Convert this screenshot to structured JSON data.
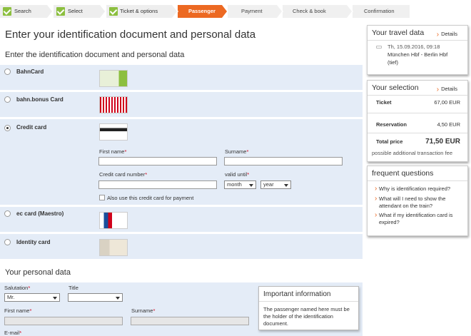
{
  "steps": [
    {
      "label": "Search",
      "state": "done"
    },
    {
      "label": "Select",
      "state": "done"
    },
    {
      "label": "Ticket & options",
      "state": "done"
    },
    {
      "label": "Passenger",
      "state": "active"
    },
    {
      "label": "Payment",
      "state": "todo"
    },
    {
      "label": "Check & book",
      "state": "todo"
    },
    {
      "label": "Confirmation",
      "state": "todo"
    }
  ],
  "page_title": "Enter your identification document and personal data",
  "subtitle": "Enter the identification document and personal data",
  "options": {
    "bahncard": "BahnCard",
    "bonus": "bahn.bonus Card",
    "credit": "Credit card",
    "ec": "ec card (Maestro)",
    "identity": "Identity card"
  },
  "credit_form": {
    "first_name": "First name",
    "surname": "Surname",
    "card_number": "Credit card number",
    "valid_until": "valid until",
    "month": "month",
    "year": "year",
    "also_use": "Also use this credit card for payment",
    "req": "*"
  },
  "personal": {
    "heading": "Your personal data",
    "salutation": "Salutation",
    "salutation_value": "Mr.",
    "title": "Title",
    "title_value": "",
    "first_name": "First name",
    "surname": "Surname",
    "email": "E-mail"
  },
  "info_box": {
    "title": "Important information",
    "text": "The passenger named here must be the holder of the identification document."
  },
  "travel": {
    "heading": "Your travel data",
    "details": "Details",
    "date": "Th, 15.09.2016, 09:18",
    "route": "München Hbf - Berlin Hbf",
    "route2": "(tief)"
  },
  "selection": {
    "heading": "Your selection",
    "details": "Details",
    "ticket_label": "Ticket",
    "ticket_value": "67,00 EUR",
    "reservation_label": "Reservation",
    "reservation_value": "4,50 EUR",
    "total_label": "Total price",
    "total_value": "71,50 EUR",
    "fee_note": "possible additional transaction fee"
  },
  "faq": {
    "heading": "frequent questions",
    "q1": "Why is identification required?",
    "q2": "What will I need to show the attendant on the train?",
    "q3": "What if my identification card is expired?"
  },
  "colors": {
    "accent": "#ec6922",
    "done": "#8cbf3f",
    "panel": "#e4ecf7",
    "required": "#d0021b"
  }
}
